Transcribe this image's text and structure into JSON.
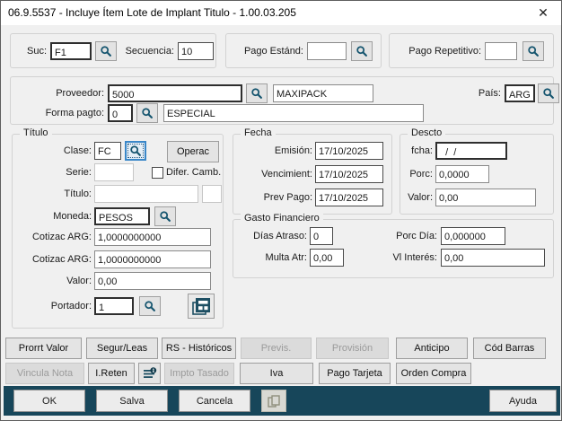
{
  "window": {
    "title": "06.9.5537 - Incluye Ítem Lote de Implant Titulo - 1.00.03.205",
    "close_glyph": "✕"
  },
  "colors": {
    "footer_teal": "#17465a",
    "icon_teal": "#1d5066",
    "focus_blue": "#3a87c8"
  },
  "top": {
    "suc_label": "Suc:",
    "suc_value": "F1",
    "secuencia_label": "Secuencia:",
    "secuencia_value": "10",
    "pago_estand_label": "Pago Estánd:",
    "pago_estand_value": "",
    "pago_repetitivo_label": "Pago Repetitivo:",
    "pago_repetitivo_value": ""
  },
  "proveedor": {
    "proveedor_label": "Proveedor:",
    "code": "5000",
    "name": "MAXIPACK",
    "pais_label": "País:",
    "pais_value": "ARG",
    "forma_label": "Forma pagto:",
    "forma_code": "0",
    "forma_desc": "ESPECIAL"
  },
  "titulo": {
    "legend": "Título",
    "clase_label": "Clase:",
    "clase_value": "FC",
    "operac_label": "Operac",
    "serie_label": "Serie:",
    "serie_value": "",
    "difer_camb_label": "Difer. Camb.",
    "titulo_label": "Título:",
    "titulo_value": "",
    "titulo_extra_value": "",
    "moneda_label": "Moneda:",
    "moneda_value": "PESOS",
    "cotizac1_label": "Cotizac ARG:",
    "cotizac1_value": "1,0000000000",
    "cotizac2_label": "Cotizac ARG:",
    "cotizac2_value": "1,0000000000",
    "valor_label": "Valor:",
    "valor_value": "0,00",
    "portador_label": "Portador:",
    "portador_value": "1"
  },
  "fecha": {
    "legend": "Fecha",
    "emision_label": "Emisión:",
    "emision_value": "17/10/2025",
    "vencimient_label": "Vencimient:",
    "vencimient_value": "17/10/2025",
    "prev_pago_label": "Prev Pago:",
    "prev_pago_value": "17/10/2025"
  },
  "descto": {
    "legend": "Descto",
    "fcha_label": "fcha:",
    "fcha_value": "  /  /",
    "porc_label": "Porc:",
    "porc_value": "0,0000",
    "valor_label": "Valor:",
    "valor_value": "0,00"
  },
  "gasto": {
    "legend": "Gasto Financiero",
    "dias_atraso_label": "Días Atraso:",
    "dias_atraso_value": "0",
    "porc_dia_label": "Porc Día:",
    "porc_dia_value": "0,000000",
    "multa_atr_label": "Multa Atr:",
    "multa_atr_value": "0,00",
    "vl_interes_label": "Vl Interés:",
    "vl_interes_value": "0,00"
  },
  "buttons_row1": [
    {
      "label": "Prorrt Valor",
      "enabled": true
    },
    {
      "label": "Segur/Leas",
      "enabled": true
    },
    {
      "label": "RS - Históricos",
      "enabled": true
    },
    {
      "label": "Previs.",
      "enabled": false
    },
    {
      "label": "Provisión",
      "enabled": false
    },
    {
      "label": "Anticipo",
      "enabled": true
    },
    {
      "label": "Cód Barras",
      "enabled": true
    }
  ],
  "buttons_row2": [
    {
      "label": "Vincula Nota",
      "enabled": false
    },
    {
      "label": "I.Reten",
      "enabled": true
    },
    {
      "label": "Impto Tasado",
      "enabled": false
    },
    {
      "label": "Iva",
      "enabled": true
    },
    {
      "label": "Pago Tarjeta",
      "enabled": true
    },
    {
      "label": "Orden Compra",
      "enabled": true
    }
  ],
  "footer": {
    "ok_label": "OK",
    "salva_label": "Salva",
    "cancela_label": "Cancela",
    "ayuda_label": "Ayuda"
  }
}
